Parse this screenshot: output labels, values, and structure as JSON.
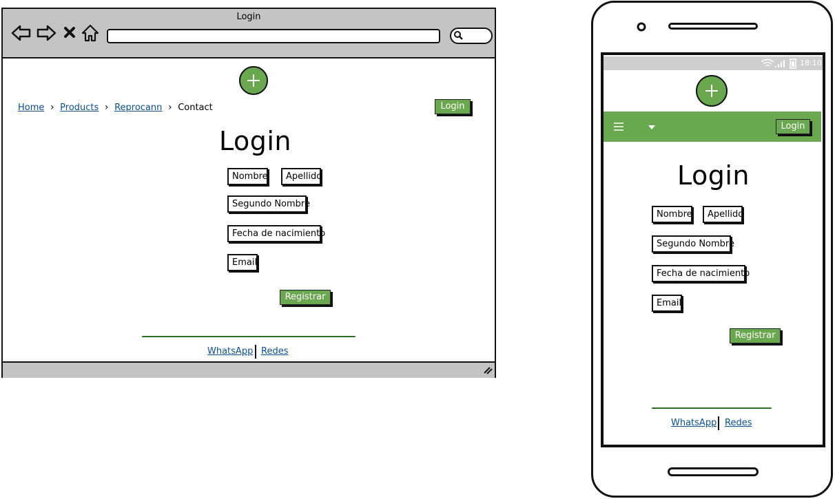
{
  "browser": {
    "title": "Login",
    "breadcrumb": [
      "Home",
      "Products",
      "Reprocann",
      "Contact"
    ],
    "login_button": "Login",
    "heading": "Login",
    "fields": [
      "Nombre",
      "Apellido",
      "Segundo Nombre",
      "Fecha de nacimiento",
      "Email"
    ],
    "submit_button": "Registrar",
    "footer": [
      "WhatsApp",
      "Redes"
    ]
  },
  "phone": {
    "status_time": "18:10",
    "login_button": "Login",
    "heading": "Login",
    "fields": [
      "Nombre",
      "Apellido",
      "Segundo Nombre",
      "Fecha de nacimiento",
      "Email"
    ],
    "submit_button": "Registrar",
    "footer": [
      "WhatsApp",
      "Redes"
    ]
  },
  "colors": {
    "accent": "#6aa84f",
    "link": "#0b4f93",
    "chrome": "#c4c4c4"
  },
  "icons": [
    "back-icon",
    "forward-icon",
    "close-icon",
    "home-icon",
    "search-icon",
    "plus-icon",
    "hamburger-icon",
    "dropdown-caret-icon",
    "wifi-icon",
    "signal-icon",
    "battery-icon",
    "resize-grip-icon"
  ]
}
